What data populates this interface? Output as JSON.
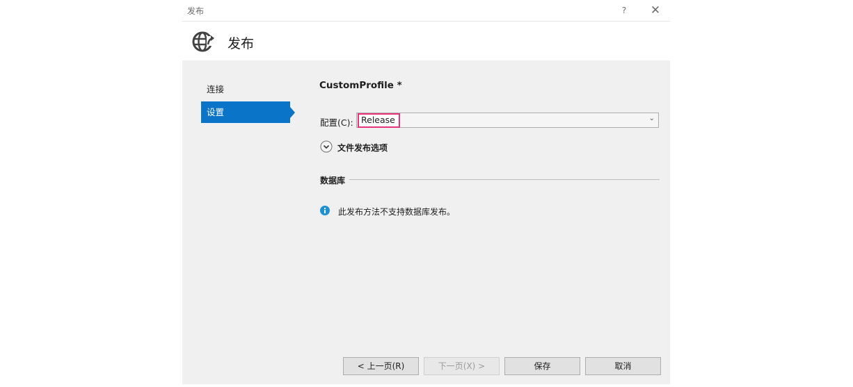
{
  "window": {
    "title": "发布",
    "help_glyph": "?",
    "close_glyph": "✕"
  },
  "header": {
    "title": "发布",
    "icon": "globe-publish-icon"
  },
  "nav": {
    "items": [
      {
        "label": "连接",
        "selected": false
      },
      {
        "label": "设置",
        "selected": true
      }
    ]
  },
  "settings": {
    "profile_name": "CustomProfile *",
    "config_label": "配置(C):",
    "config_value": "Release",
    "config_dropdown_glyph": "⌄",
    "file_publish_options_label": "文件发布选项",
    "database_section_label": "数据库",
    "database_info": "此发布方法不支持数据库发布。"
  },
  "buttons": {
    "prev": "< 上一页(R)",
    "next": "下一页(X) >",
    "save": "保存",
    "cancel": "取消"
  },
  "colors": {
    "accent": "#0a74c9",
    "highlight_border": "#e8347b",
    "info": "#1e90d6"
  }
}
